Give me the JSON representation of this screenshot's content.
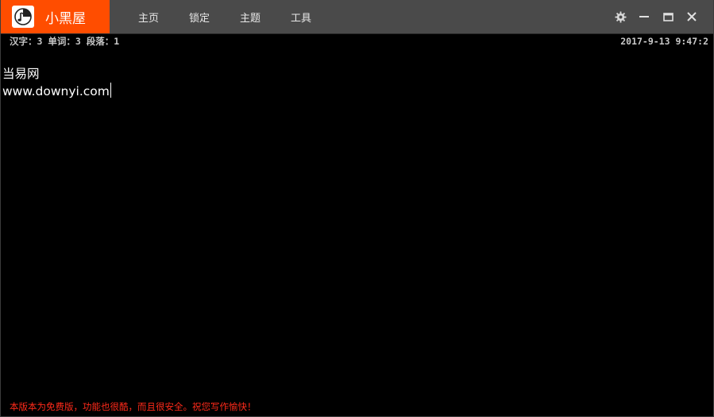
{
  "app": {
    "name": "小黑屋",
    "brand_color": "#ff4d00",
    "logo_icon": "clock-note-icon"
  },
  "nav": {
    "items": [
      {
        "label": "主页"
      },
      {
        "label": "锁定"
      },
      {
        "label": "主题"
      },
      {
        "label": "工具"
      }
    ]
  },
  "window_controls": {
    "settings_icon": "gear-icon",
    "minimize_icon": "minimize-icon",
    "maximize_icon": "maximize-icon",
    "close_icon": "close-icon"
  },
  "status": {
    "stats": "汉字：3 单词：3 段落：1",
    "datetime": "2017-9-13 9:47:2"
  },
  "editor": {
    "lines": [
      "当易网",
      "www.downyi.com"
    ],
    "text_color": "#ffffff",
    "background": "#000000"
  },
  "footer": {
    "note": "本版本为免费版，功能也很酷，而且很安全。祝您写作愉快！",
    "color": "#ff2a1a"
  }
}
